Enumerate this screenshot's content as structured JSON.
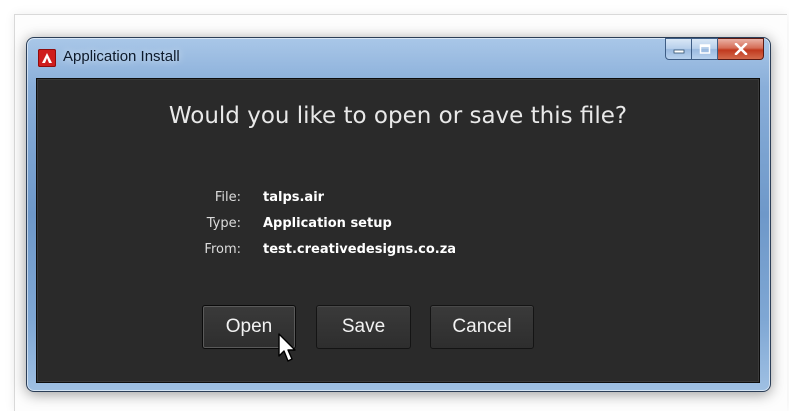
{
  "window": {
    "title": "Application Install",
    "icon": "adobe-air-icon",
    "controls": [
      "minimize-icon",
      "maximize-icon",
      "close-icon"
    ]
  },
  "dialog": {
    "question": "Would you like to open or save this file?",
    "fields": [
      {
        "label": "File:",
        "value": "talps.air"
      },
      {
        "label": "Type:",
        "value": "Application setup"
      },
      {
        "label": "From:",
        "value": "test.creativedesigns.co.za"
      }
    ]
  },
  "buttons": {
    "open": "Open",
    "save": "Save",
    "cancel": "Cancel"
  },
  "colors": {
    "client_background": "#2a2a2a",
    "titlebar": "#89aed9",
    "close_button": "#c1391e",
    "app_icon": "#cf1d1d"
  }
}
